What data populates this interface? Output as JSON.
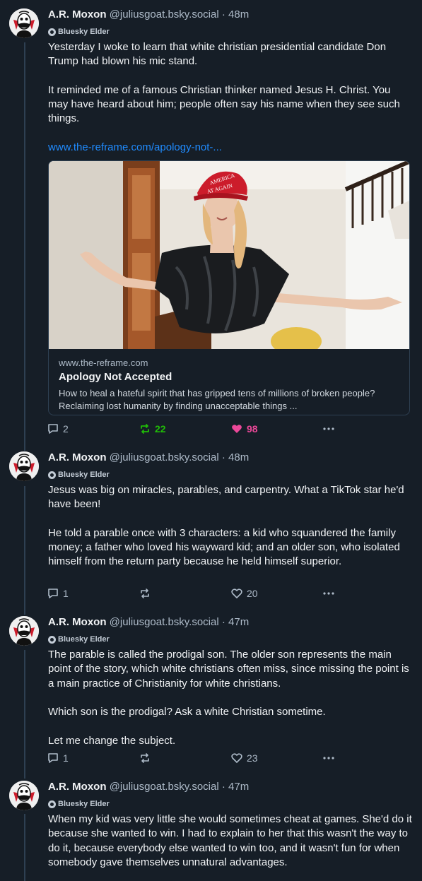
{
  "posts": [
    {
      "author": "A.R. Moxon",
      "handle": "@juliusgoat.bsky.social",
      "time": "48m",
      "badge": "Bluesky Elder",
      "paragraphs": [
        "Yesterday I woke to learn that white christian presidential candidate Don Trump had blown his mic stand.",
        "It reminded me of a famous Christian thinker named Jesus H. Christ. You may have heard about him; people often say his name when they see such things."
      ],
      "link_text": "www.the-reframe.com/apology-not-...",
      "card": {
        "hat_text_1": "AMERICA",
        "hat_text_2": "AT AGAIN",
        "domain": "www.the-reframe.com",
        "title": "Apology Not Accepted",
        "description": "How to heal a hateful spirit that has gripped tens of millions of broken people? Reclaiming lost humanity by finding unacceptable things ..."
      },
      "replies": "2",
      "reposts": "22",
      "likes": "98"
    },
    {
      "author": "A.R. Moxon",
      "handle": "@juliusgoat.bsky.social",
      "time": "48m",
      "badge": "Bluesky Elder",
      "paragraphs": [
        "Jesus was big on miracles, parables, and carpentry. What a TikTok star he'd have been!",
        "He told a parable once with 3 characters: a kid who squandered the family money; a father who loved his wayward kid; and an older son, who isolated himself from the return party because he held himself superior."
      ],
      "replies": "1",
      "reposts": "",
      "likes": "20"
    },
    {
      "author": "A.R. Moxon",
      "handle": "@juliusgoat.bsky.social",
      "time": "47m",
      "badge": "Bluesky Elder",
      "paragraphs": [
        "The parable is called the prodigal son. The older son represents the main point of the story, which white christians often miss, since missing the point is a main practice of Christianity for white christians.",
        "Which son is the prodigal? Ask a white Christian sometime.",
        "Let me change the subject."
      ],
      "replies": "1",
      "reposts": "",
      "likes": "23"
    },
    {
      "author": "A.R. Moxon",
      "handle": "@juliusgoat.bsky.social",
      "time": "47m",
      "badge": "Bluesky Elder",
      "paragraphs": [
        "When my kid was very little she would sometimes cheat at games. She'd do it because she wanted to win. I had to explain to her that this wasn't the way to do it, because everybody else wanted to win too, and it wasn't fun for when somebody gave themselves unnatural advantages."
      ]
    }
  ],
  "colors": {
    "background": "#161e27",
    "link": "#208bfe",
    "repost_active": "#20bc07",
    "like_active": "#ec4899",
    "muted": "#aebbc9"
  },
  "icons": {
    "reply": "speech-bubble-icon",
    "repost": "repost-arrows-icon",
    "like": "heart-icon",
    "more": "ellipsis-icon",
    "badge": "bluesky-elder-badge-icon"
  },
  "separator": " · "
}
